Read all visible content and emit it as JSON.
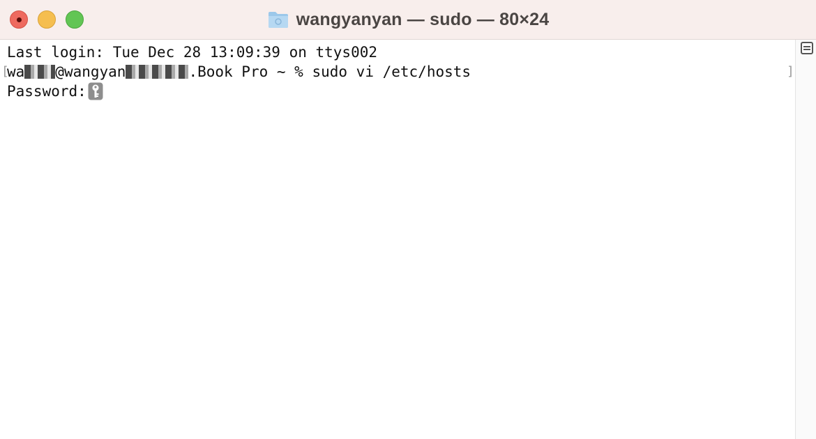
{
  "window": {
    "title": "wangyanyan — sudo — 80×24"
  },
  "terminal": {
    "line1": "Last login: Tue Dec 28 13:09:39 on ttys002",
    "prompt_visible_start": "wa",
    "prompt_visible_mid": "@wangyan",
    "prompt_visible_end": ".Book Pro",
    "command": " ~ % sudo vi /etc/hosts",
    "password_label": "Password:"
  },
  "icons": {
    "title_icon": "folder-icon",
    "password_icon": "key-icon",
    "scroll_icon": "marks-icon"
  },
  "colors": {
    "close": "#ee6a5f",
    "minimize": "#f5be4f",
    "maximize": "#62c554",
    "titlebar": "#f8eeec",
    "folder": "#9cc8ea"
  }
}
